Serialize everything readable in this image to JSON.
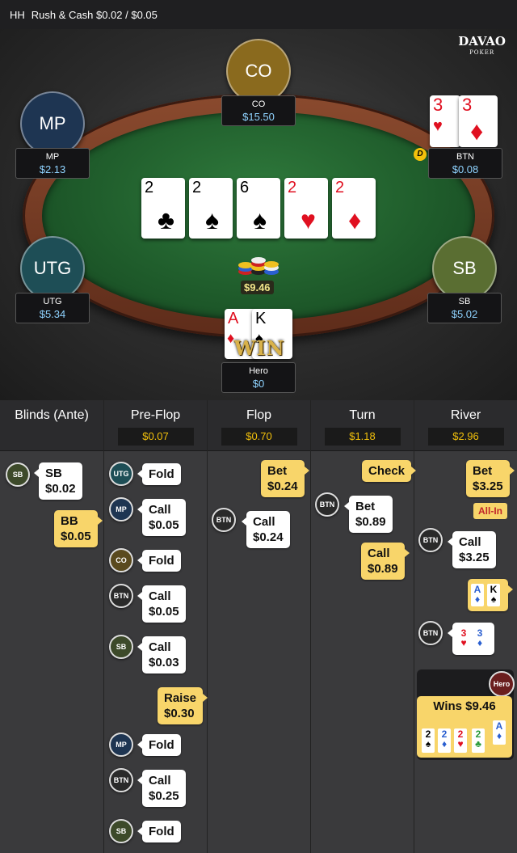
{
  "title": {
    "prefix": "HH",
    "game": "Rush & Cash $0.02 / $0.05"
  },
  "logo": {
    "main": "DAVAO",
    "sub": "POKER"
  },
  "seats": {
    "co": {
      "label": "CO",
      "name": "CO",
      "stack": "$15.50",
      "color": "#8a6a1e"
    },
    "mp": {
      "label": "MP",
      "name": "MP",
      "stack": "$2.13",
      "color": "#1e3552"
    },
    "btn": {
      "name": "BTN",
      "stack": "$0.08"
    },
    "utg": {
      "label": "UTG",
      "name": "UTG",
      "stack": "$5.34",
      "color": "#1e4e56"
    },
    "sb": {
      "label": "SB",
      "name": "SB",
      "stack": "$5.02",
      "color": "#5a6e32"
    },
    "hero": {
      "name": "Hero",
      "stack": "$0"
    }
  },
  "dealer_label": "D",
  "board": [
    {
      "rank": "2",
      "suit": "♣",
      "color": "black"
    },
    {
      "rank": "2",
      "suit": "♠",
      "color": "black"
    },
    {
      "rank": "6",
      "suit": "♠",
      "color": "black"
    },
    {
      "rank": "2",
      "suit": "♥",
      "color": "red"
    },
    {
      "rank": "2",
      "suit": "♦",
      "color": "red"
    }
  ],
  "btn_cards": [
    {
      "rank": "3",
      "suit": "♥"
    },
    {
      "rank": "3",
      "suit": "♦"
    }
  ],
  "hero_cards": [
    {
      "rank": "A",
      "suit": "♦"
    },
    {
      "rank": "K",
      "suit": "♠"
    }
  ],
  "pot": "$9.46",
  "win_text": "WIN",
  "history": {
    "columns": [
      {
        "title": "Blinds (Ante)",
        "pot": ""
      },
      {
        "title": "Pre-Flop",
        "pot": "$0.07"
      },
      {
        "title": "Flop",
        "pot": "$0.70"
      },
      {
        "title": "Turn",
        "pot": "$1.18"
      },
      {
        "title": "River",
        "pot": "$2.96"
      }
    ],
    "blinds": {
      "sb": "SB\n$0.02",
      "bb": "BB\n$0.05"
    },
    "preflop": {
      "a1": "Fold",
      "a2": "Call\n$0.05",
      "a3": "Fold",
      "a4": "Call\n$0.05",
      "a5": "Call\n$0.03",
      "a6": "Raise\n$0.30",
      "a7": "Fold",
      "a8": "Call\n$0.25",
      "a9": "Fold"
    },
    "flop": {
      "a1": "Bet\n$0.24",
      "a2": "Call\n$0.24"
    },
    "turn": {
      "a1": "Check",
      "a2": "Bet\n$0.89",
      "a3": "Call\n$0.89"
    },
    "river": {
      "a1": "Bet\n$3.25",
      "allin": "All-In",
      "a2": "Call\n$3.25"
    },
    "chips": {
      "sb": "SB",
      "utg": "UTG",
      "mp": "MP",
      "co": "CO",
      "btn": "BTN",
      "hero": "Hero"
    },
    "wins": "Wins $9.46"
  }
}
